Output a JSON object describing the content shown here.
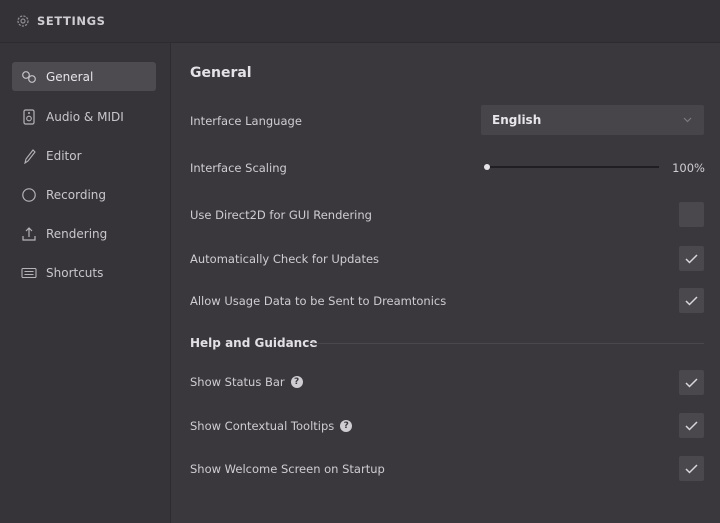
{
  "window": {
    "title": "SETTINGS"
  },
  "sidebar": {
    "items": [
      {
        "label": "General",
        "icon": "general-icon",
        "active": true
      },
      {
        "label": "Audio & MIDI",
        "icon": "audio-midi-icon"
      },
      {
        "label": "Editor",
        "icon": "editor-icon"
      },
      {
        "label": "Recording",
        "icon": "recording-icon"
      },
      {
        "label": "Rendering",
        "icon": "rendering-icon"
      },
      {
        "label": "Shortcuts",
        "icon": "keyboard-icon"
      }
    ]
  },
  "general": {
    "title": "General",
    "interface_language": {
      "label": "Interface Language",
      "value": "English"
    },
    "interface_scaling": {
      "label": "Interface Scaling",
      "value": "100%",
      "fraction": 0.0
    },
    "direct2d": {
      "label": "Use Direct2D for GUI Rendering",
      "checked": false
    },
    "auto_update": {
      "label": "Automatically Check for Updates",
      "checked": true
    },
    "usage_data": {
      "label": "Allow Usage Data to be Sent to Dreamtonics",
      "checked": true
    }
  },
  "help": {
    "title": "Help and Guidance",
    "status_bar": {
      "label": "Show Status Bar",
      "checked": true,
      "help_glyph": "?"
    },
    "tooltips": {
      "label": "Show Contextual Tooltips",
      "checked": true,
      "help_glyph": "?"
    },
    "welcome": {
      "label": "Show Welcome Screen on Startup",
      "checked": true
    }
  },
  "colors": {
    "background": "#3a383c",
    "sidebar": "#363438",
    "active_item": "#4d4b50",
    "control": "#4a484d"
  }
}
